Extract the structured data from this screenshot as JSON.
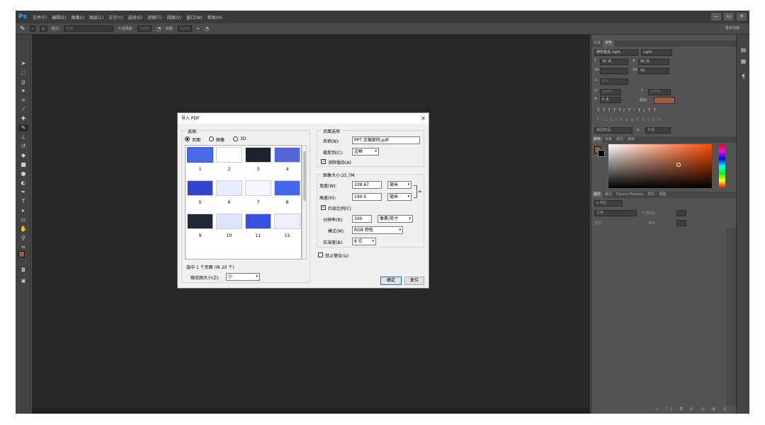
{
  "app": {
    "logo": "Ps"
  },
  "menubar": {
    "items": [
      "文件(F)",
      "编辑(E)",
      "图像(I)",
      "图层(L)",
      "文字(Y)",
      "选择(S)",
      "滤镜(T)",
      "视图(V)",
      "窗口(W)",
      "帮助(H)"
    ],
    "win_min": "—",
    "win_max": "▭",
    "win_close": "✕"
  },
  "options": {
    "mode_label": "模式:",
    "mode_value": "正常",
    "opacity_label": "不透明度:",
    "opacity_value": "100%",
    "flow_label": "流量:",
    "flow_value": "100%",
    "workspace": "基本功能"
  },
  "character_panel": {
    "tabs": [
      "段落",
      "字符"
    ],
    "font_family": "微软雅黑 Light",
    "font_style": "Light",
    "size": "30 点",
    "leading": "80 点",
    "kerning": "",
    "tracking": "50",
    "vscale": "0%",
    "hscale_a": "100%",
    "hscale_b": "100%",
    "baseline": "0 点",
    "color_label": "颜色:",
    "typo_buttons": [
      "T",
      "T",
      "TT",
      "Tr",
      "T¹",
      "T₁",
      "T",
      "T"
    ],
    "otype_buttons": [
      "fi",
      "ℴ",
      "st",
      "A",
      "aa",
      "T",
      "1st",
      "½"
    ],
    "language": "美国英语",
    "aa_label": "a",
    "aa_value": "平滑"
  },
  "color_panel": {
    "tabs": [
      "颜色",
      "色板",
      "属性",
      "通道"
    ]
  },
  "layers_panel": {
    "tabs": [
      "图层",
      "路径",
      "Device Preview",
      "样式",
      "调整"
    ],
    "filter_label": "ρ 类型",
    "blend_mode": "正常",
    "opacity_label": "不透明度:",
    "lock_label": "锁定:",
    "fill_label": "填充:"
  },
  "colors": {
    "accent": "#31a8ff",
    "brush_swatch": "#a05a3c",
    "fg_color": "#a05a3c",
    "bg_color": "#ffffff"
  },
  "dialog": {
    "title": "导入 PDF",
    "close": "✕",
    "select_group": "选择:",
    "radio_page": "页面",
    "radio_image": "图像",
    "radio_3d": "3D",
    "pages": [
      {
        "num": "1",
        "color": "#4a6ae8"
      },
      {
        "num": "2",
        "color": "#ffffff"
      },
      {
        "num": "3",
        "color": "#1c2230"
      },
      {
        "num": "4",
        "color": "#5566dd"
      },
      {
        "num": "5",
        "color": "#3344cc"
      },
      {
        "num": "6",
        "color": "#e8ecff"
      },
      {
        "num": "7",
        "color": "#f5f6ff"
      },
      {
        "num": "8",
        "color": "#4466ee"
      },
      {
        "num": "9",
        "color": "#222834"
      },
      {
        "num": "10",
        "color": "#dde4ff"
      },
      {
        "num": "11",
        "color": "#3650e0"
      },
      {
        "num": "12",
        "color": "#eef0ff"
      }
    ],
    "selection_info": "选中 1 个页面 (共 20 个)",
    "thumb_size_label": "缩览图大小(Z):",
    "thumb_size_value": "小",
    "page_options_group": "页面选项",
    "name_label": "名称(N):",
    "name_value": "PPT 文稿案例.pdf",
    "crop_label": "裁剪到(C):",
    "crop_value": "边框",
    "antialias_label": "消除锯齿(A)",
    "image_size_group": "图像大小:25.7M",
    "width_label": "宽度(W):",
    "width_value": "338.67",
    "width_unit": "毫米",
    "height_label": "高度(H):",
    "height_value": "190.5",
    "height_unit": "毫米",
    "constrain_label": "约束比例(C)",
    "resolution_label": "分辨率(R):",
    "resolution_value": "300",
    "resolution_unit": "像素/英寸",
    "mode_label": "模式(M):",
    "mode_value": "RGB 颜色",
    "depth_label": "位深度(B):",
    "depth_value": "8 位",
    "suppress_label": "禁止警告(U)",
    "ok": "确定",
    "reset": "复位"
  }
}
